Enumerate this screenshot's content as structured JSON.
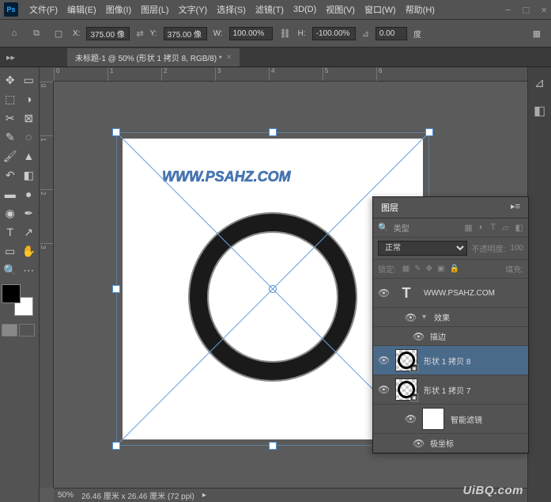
{
  "menubar": [
    "文件(F)",
    "编辑(E)",
    "图像(I)",
    "图层(L)",
    "文字(Y)",
    "选择(S)",
    "滤镜(T)",
    "3D(D)",
    "视图(V)",
    "窗口(W)",
    "帮助(H)"
  ],
  "options": {
    "x_label": "X:",
    "x_value": "375.00 像",
    "y_label": "Y:",
    "y_value": "375.00 像",
    "w_label": "W:",
    "w_value": "100.00%",
    "h_label": "H:",
    "h_value": "-100.00%",
    "angle_value": "0.00",
    "angle_unit": "度"
  },
  "doc_tab": "未标题-1 @ 50% (形状 1 拷贝 8, RGB/8) *",
  "ruler_h": [
    "0",
    "1",
    "2",
    "3",
    "4",
    "5",
    "6"
  ],
  "ruler_v": [
    "0",
    "1",
    "2",
    "3"
  ],
  "canvas": {
    "watermark": "WWW.PSAHZ.COM"
  },
  "status": {
    "zoom": "50%",
    "doc_info": "26.46 厘米 x 26.46 厘米 (72 ppi)"
  },
  "layers_panel": {
    "title": "图层",
    "filter_label": "类型",
    "blend_mode": "正常",
    "opacity_label": "不透明度:",
    "opacity_value": "100",
    "lock_label": "锁定:",
    "fill_label": "填充:",
    "items": [
      {
        "type": "text",
        "name": "WWW.PSAHZ.COM"
      },
      {
        "type": "fx-header",
        "name": "效果"
      },
      {
        "type": "fx-item",
        "name": "描边"
      },
      {
        "type": "shape",
        "name": "形状 1 拷贝 8",
        "selected": true
      },
      {
        "type": "shape",
        "name": "形状 1 拷贝 7"
      },
      {
        "type": "smart",
        "name": "智能滤镜"
      },
      {
        "type": "filter-item",
        "name": "极坐标"
      }
    ]
  },
  "bottom_watermark": "UiBQ.com"
}
